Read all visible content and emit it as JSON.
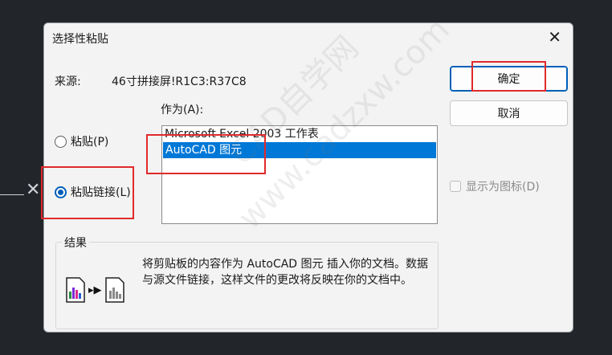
{
  "dialog": {
    "title": "选择性粘贴",
    "close_glyph": "✕",
    "source_label": "来源:",
    "source_value": "46寸拼接屏!R1C3:R37C8",
    "as_label": "作为(A):",
    "paste_radio": "粘贴(P)",
    "paste_link_radio": "粘贴链接(L)",
    "list_items": [
      "Microsoft Excel 2003 工作表",
      "AutoCAD 图元"
    ],
    "ok_button": "确定",
    "cancel_button": "取消",
    "display_as_icon": "显示为图标(D)",
    "result_title": "结果",
    "result_text": "将剪贴板的内容作为 AutoCAD 图元 插入你的文档。数据与源文件链接，这样文件的更改将反映在你的文档中。",
    "result_arrow": "▸▶"
  },
  "background": {
    "cross_glyph": "✕"
  },
  "watermark": {
    "text1": "CAD自学网",
    "text2": "www.cadzxw.com"
  },
  "colors": {
    "accent": "#005fb8",
    "selection": "#0078d7",
    "highlight": "#e02a2a"
  },
  "icons": [
    "close-icon",
    "chart-doc-icon",
    "arrow-icon",
    "gray-doc-icon"
  ]
}
